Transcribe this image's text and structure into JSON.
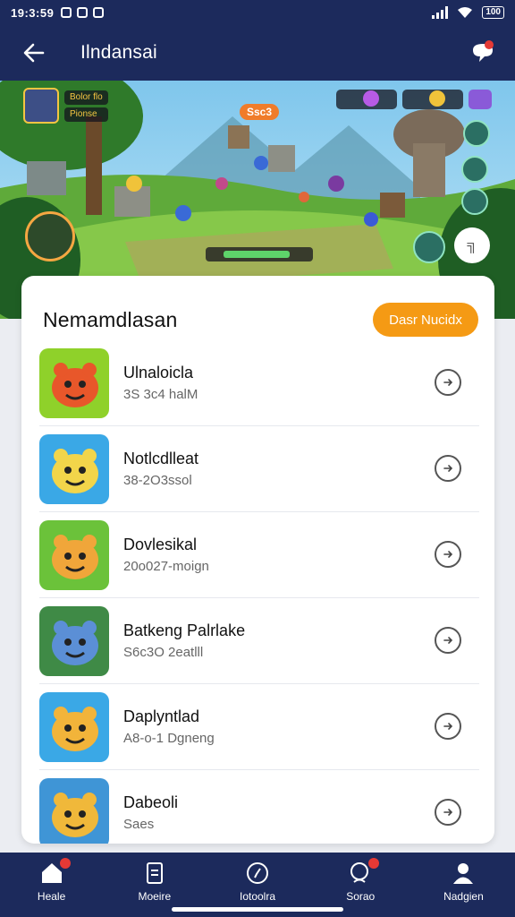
{
  "status_bar": {
    "time": "19:3:59",
    "battery": "100"
  },
  "header": {
    "title": "Ilndansai",
    "back_icon": "arrow-left-icon",
    "chat_icon": "chat-bubble-icon"
  },
  "banner": {
    "player_tag_top": "Bolor flo",
    "player_tag_bottom": "Pionse",
    "score": "Ssc3",
    "corner_button": "╗"
  },
  "card": {
    "title": "Nemamdlasan",
    "action_label": "Dasr Nucidx",
    "games": [
      {
        "name": "Ulnaloicla",
        "meta": "3S 3c4 halM",
        "thumb_bg": "#8fd12a",
        "char_color": "#e8572a"
      },
      {
        "name": "Notlcdlleat",
        "meta": "38-2O3ssol",
        "thumb_bg": "#3aa8e6",
        "char_color": "#f2d54a"
      },
      {
        "name": "Dovlesikal",
        "meta": "20o027-moign",
        "thumb_bg": "#6bc23a",
        "char_color": "#f0a63a"
      },
      {
        "name": "Batkeng Palrlake",
        "meta": "S6c3O 2eatlll",
        "thumb_bg": "#3f8a46",
        "char_color": "#5b8fd6"
      },
      {
        "name": "Daplyntlad",
        "meta": "A8-o-1 Dgneng",
        "thumb_bg": "#3aa8e6",
        "char_color": "#f2b43a"
      },
      {
        "name": "Dabeoli",
        "meta": "Saes",
        "thumb_bg": "#3f95d6",
        "char_color": "#f0b83a"
      }
    ]
  },
  "nav": {
    "items": [
      {
        "label": "Heale",
        "icon": "home-icon",
        "badge": true
      },
      {
        "label": "Moeire",
        "icon": "document-icon",
        "badge": false
      },
      {
        "label": "Iotoolra",
        "icon": "compass-icon",
        "badge": false
      },
      {
        "label": "Sorao",
        "icon": "search-icon",
        "badge": true
      },
      {
        "label": "Nadgien",
        "icon": "person-icon",
        "badge": false
      }
    ]
  },
  "colors": {
    "navy": "#1c2a5c",
    "accent_orange": "#f59a14",
    "badge_red": "#e53935"
  }
}
